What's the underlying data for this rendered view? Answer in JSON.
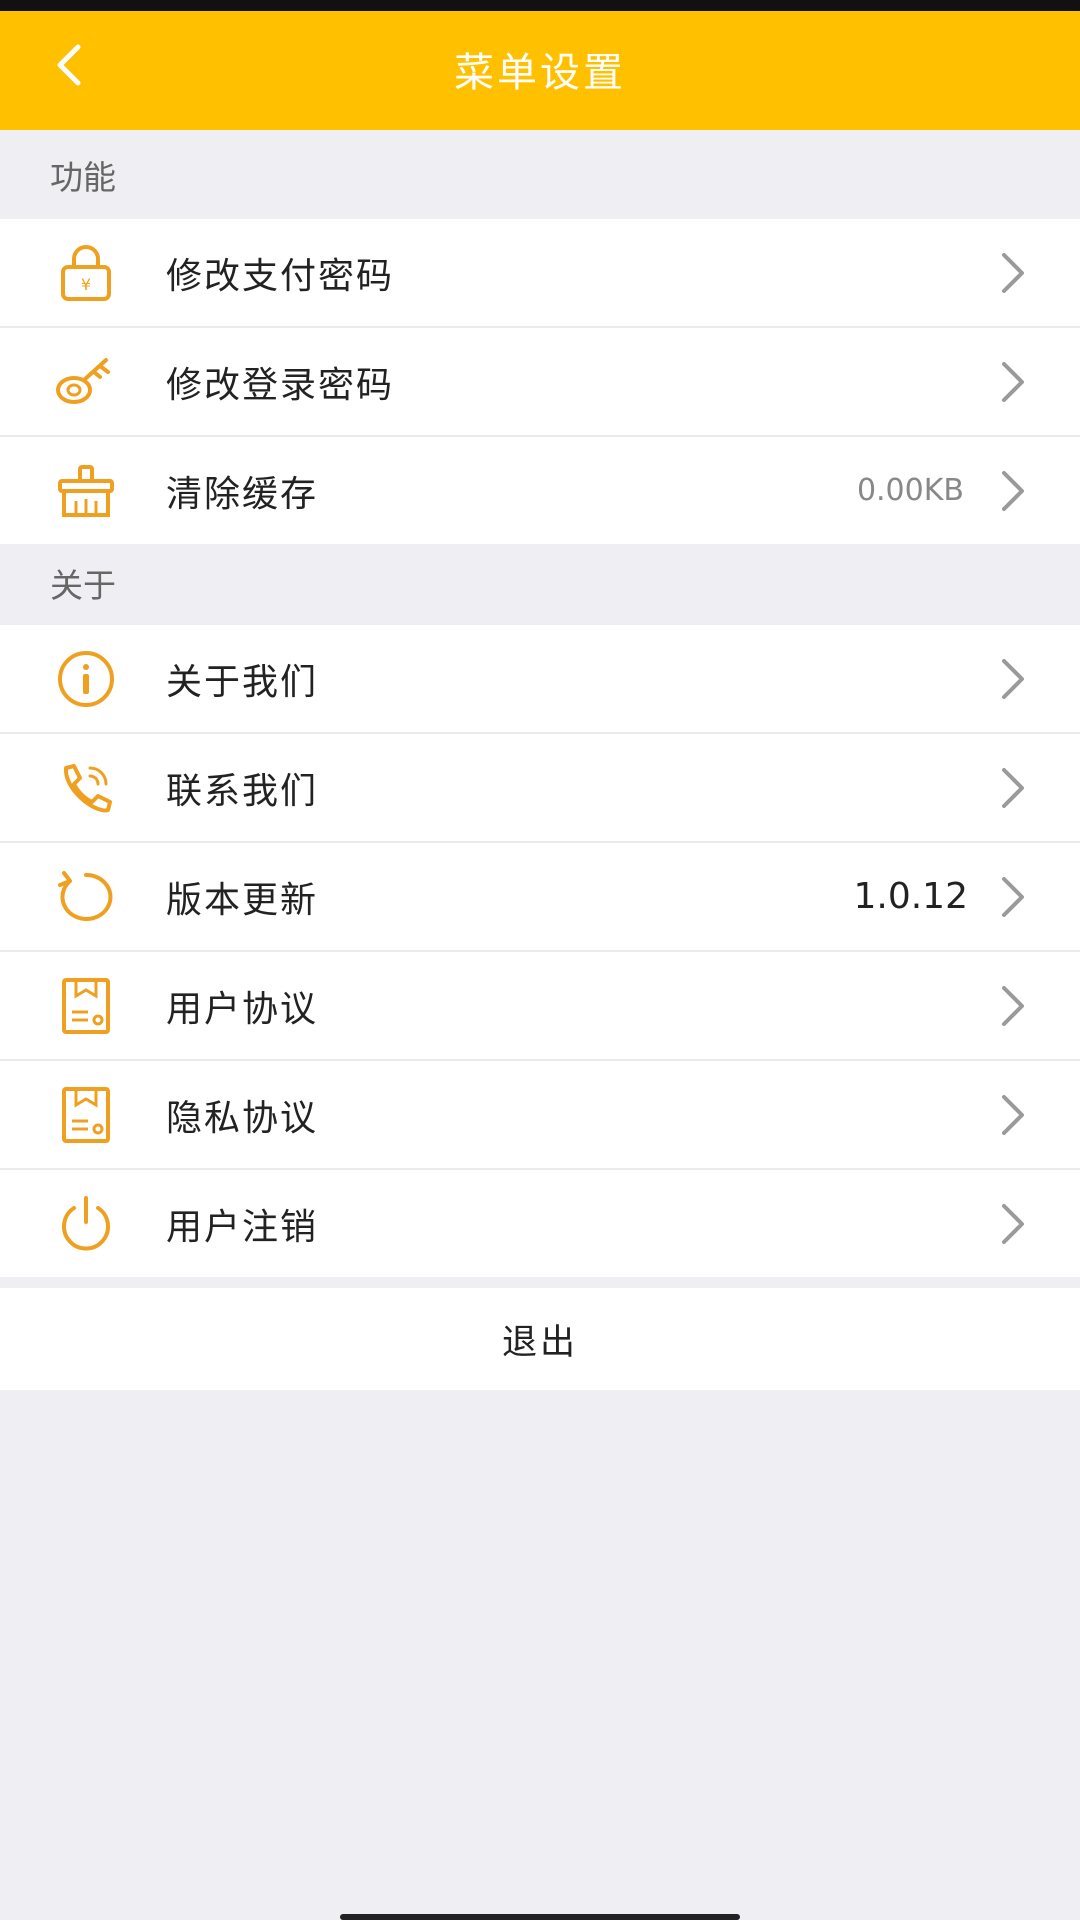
{
  "header": {
    "title": "菜单设置",
    "back_icon": "chevron-left-icon",
    "background": "#ffc000"
  },
  "sections": {
    "function_label": "功能",
    "about_label": "关于"
  },
  "function_items": [
    {
      "label": "修改支付密码",
      "icon": "lock-yen-icon",
      "value": ""
    },
    {
      "label": "修改登录密码",
      "icon": "key-icon",
      "value": ""
    },
    {
      "label": "清除缓存",
      "icon": "broom-icon",
      "value": "0.00KB"
    }
  ],
  "about_items": [
    {
      "label": "关于我们",
      "icon": "info-icon",
      "value": ""
    },
    {
      "label": "联系我们",
      "icon": "phone-icon",
      "value": ""
    },
    {
      "label": "版本更新",
      "icon": "refresh-icon",
      "value": "1.0.12"
    },
    {
      "label": "用户协议",
      "icon": "document-icon",
      "value": ""
    },
    {
      "label": "隐私协议",
      "icon": "document-icon",
      "value": ""
    },
    {
      "label": "用户注销",
      "icon": "power-icon",
      "value": ""
    }
  ],
  "logout": {
    "label": "退出"
  },
  "colors": {
    "accent": "#ffc000",
    "icon": "#f0a020",
    "background": "#efeef2"
  }
}
